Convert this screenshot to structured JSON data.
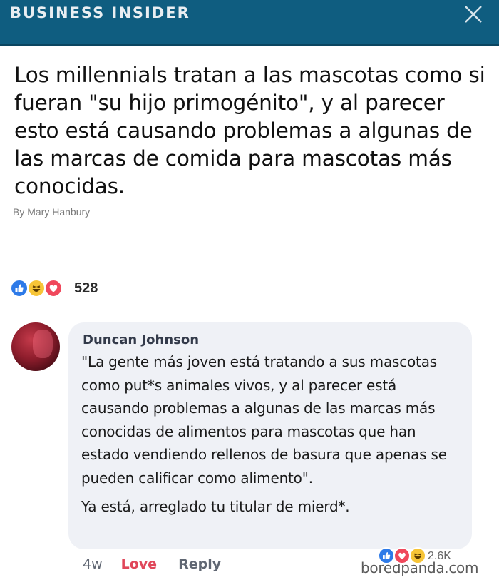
{
  "header": {
    "brand": "BUSINESS INSIDER",
    "close_icon": "close-icon",
    "background_color": "#0f5d80"
  },
  "article": {
    "headline": "Los millennials tratan a las mascotas como si fueran \"su hijo primogénito\", y al parecer esto está causando problemas a algunas de las marcas de comida para mascotas más conocidas.",
    "byline": "By Mary Hanbury"
  },
  "post_reactions": {
    "icons": [
      "like-icon",
      "haha-icon",
      "love-icon"
    ],
    "count": "528"
  },
  "comment": {
    "author": "Duncan Johnson",
    "paragraphs": [
      "\"La gente más joven está tratando a sus mascotas como put*s animales vivos, y al parecer está causando problemas a algunas de las marcas más conocidas de alimentos para mascotas que han estado vendiendo rellenos de basura que apenas se pueden calificar como alimento\".",
      "Ya está, arreglado tu titular de mierd*."
    ],
    "time": "4w",
    "love_label": "Love",
    "reply_label": "Reply",
    "reactions": {
      "icons": [
        "like-icon",
        "love-icon",
        "haha-icon"
      ],
      "count": "2.6K"
    }
  },
  "watermark": "boredpanda.com",
  "colors": {
    "like": "#2d7ae8",
    "love": "#f0485c",
    "haha": "#f7c537",
    "love_link": "#e0475a",
    "bubble": "#eff1f6"
  }
}
